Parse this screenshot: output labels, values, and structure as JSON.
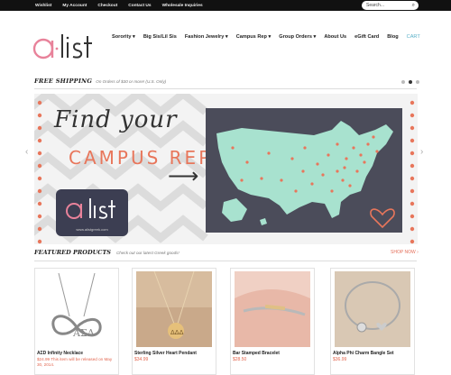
{
  "topbar": {
    "links": [
      "Wishlist",
      "My Account",
      "Checkout",
      "Contact Us",
      "Wholesale Inquiries"
    ],
    "search_placeholder": "Search..."
  },
  "nav": {
    "items": [
      {
        "label": "Sorority ▾"
      },
      {
        "label": "Big Sis/Lil Sis"
      },
      {
        "label": "Fashion Jewelry ▾"
      },
      {
        "label": "Campus Rep ▾"
      },
      {
        "label": "Group Orders ▾"
      },
      {
        "label": "About Us"
      },
      {
        "label": "eGift Card"
      },
      {
        "label": "Blog"
      }
    ],
    "cart_label": "CART"
  },
  "shipping": {
    "heading": "FREE SHIPPING",
    "subtext": "On Orders of $30 or more! (U.S. Only)"
  },
  "banner": {
    "line1": "Find your",
    "line2": "CAMPUS REP",
    "logo_text": "a·list",
    "logo_url": "www.alistgreek.com",
    "colors": {
      "coral": "#e8765b",
      "navy": "#3c3e52",
      "mint": "#a8e2cf",
      "slate": "#4b4c5a"
    }
  },
  "featured": {
    "heading": "FEATURED PRODUCTS",
    "subtext": "Check out our latest Greek goods!",
    "shop_now": "SHOP NOW ›"
  },
  "products": [
    {
      "title": "AΣD Infinity Necklace",
      "note": "$24.99 This item will be released on May 30, 2014."
    },
    {
      "title": "Sterling Silver Heart Pendant",
      "price": "$34.99"
    },
    {
      "title": "Bar Stamped Bracelet",
      "price": "$28.50"
    },
    {
      "title": "Alpha Phi Charm Bangle Set",
      "price": "$36.99"
    }
  ],
  "logo": {
    "text": "a·list",
    "colors": {
      "a": "#e8829a",
      "list": "#333"
    }
  }
}
